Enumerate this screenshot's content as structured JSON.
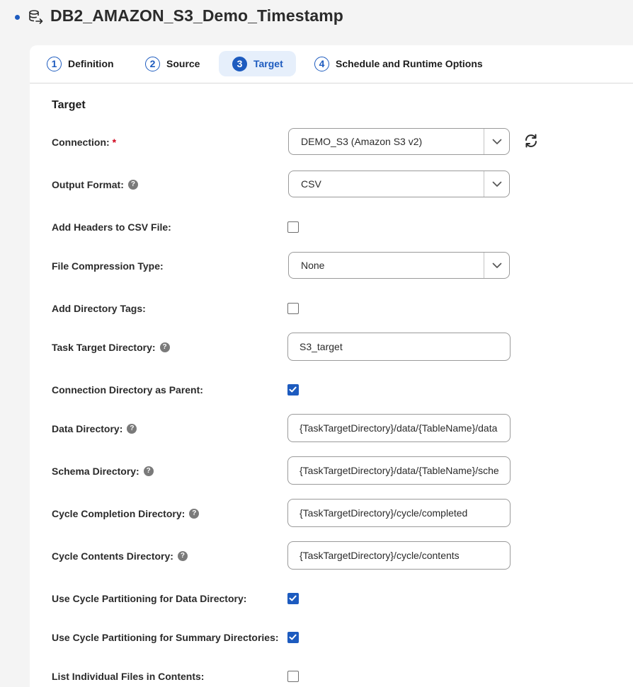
{
  "page": {
    "title": "DB2_AMAZON_S3_Demo_Timestamp"
  },
  "tabs": [
    {
      "number": "1",
      "label": "Definition",
      "active": false
    },
    {
      "number": "2",
      "label": "Source",
      "active": false
    },
    {
      "number": "3",
      "label": "Target",
      "active": true
    },
    {
      "number": "4",
      "label": "Schedule and Runtime Options",
      "active": false
    }
  ],
  "target": {
    "section_title": "Target",
    "connection": {
      "label": "Connection:",
      "required_mark": "*",
      "value": "DEMO_S3 (Amazon S3 v2)"
    },
    "output_format": {
      "label": "Output Format:",
      "help": "?",
      "value": "CSV"
    },
    "add_headers": {
      "label": "Add Headers to CSV File:",
      "checked": false
    },
    "file_compression": {
      "label": "File Compression Type:",
      "value": "None"
    },
    "add_directory_tags": {
      "label": "Add Directory Tags:",
      "checked": false
    },
    "task_target_directory": {
      "label": "Task Target Directory:",
      "help": "?",
      "value": "S3_target"
    },
    "connection_directory_parent": {
      "label": "Connection Directory as Parent:",
      "checked": true
    },
    "data_directory": {
      "label": "Data Directory:",
      "help": "?",
      "value": "{TaskTargetDirectory}/data/{TableName}/data"
    },
    "schema_directory": {
      "label": "Schema Directory:",
      "help": "?",
      "value": "{TaskTargetDirectory}/data/{TableName}/schema"
    },
    "cycle_completion_directory": {
      "label": "Cycle Completion Directory:",
      "help": "?",
      "value": "{TaskTargetDirectory}/cycle/completed"
    },
    "cycle_contents_directory": {
      "label": "Cycle Contents Directory:",
      "help": "?",
      "value": "{TaskTargetDirectory}/cycle/contents"
    },
    "cycle_partitioning_data": {
      "label": "Use Cycle Partitioning for Data Directory:",
      "checked": true
    },
    "cycle_partitioning_summary": {
      "label": "Use Cycle Partitioning for Summary Directories:",
      "checked": true
    },
    "list_individual_files": {
      "label": "List Individual Files in Contents:",
      "checked": false
    }
  },
  "colors": {
    "accent": "#1d5bbf",
    "active_tab_bg": "#e6effb",
    "required": "#d0021b"
  },
  "icons": {
    "title": "database-export-icon",
    "refresh": "refresh-icon",
    "caret": "chevron-down-icon",
    "help": "help-circle-icon",
    "check": "check-icon"
  }
}
